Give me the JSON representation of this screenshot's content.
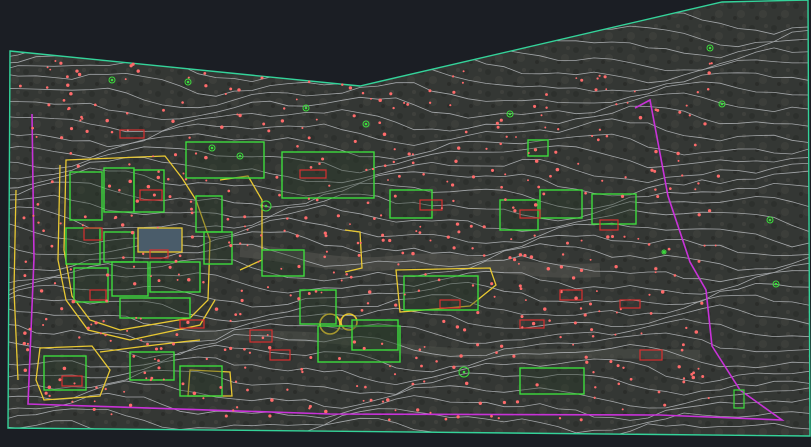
{
  "canvas": {
    "background": "#1b1e24",
    "imagery_tone": "#3a3c3a"
  },
  "layer_colors": {
    "site_boundary": "#34d39a",
    "property_line": "#c832d8",
    "contours": "#c9ccd0",
    "building_outlines": "#3ddb3d",
    "roads_paths": "#e8c832",
    "survey_points": "#ff6b6b",
    "trees": "#3ddb3d",
    "red_markers": "#d83030"
  }
}
